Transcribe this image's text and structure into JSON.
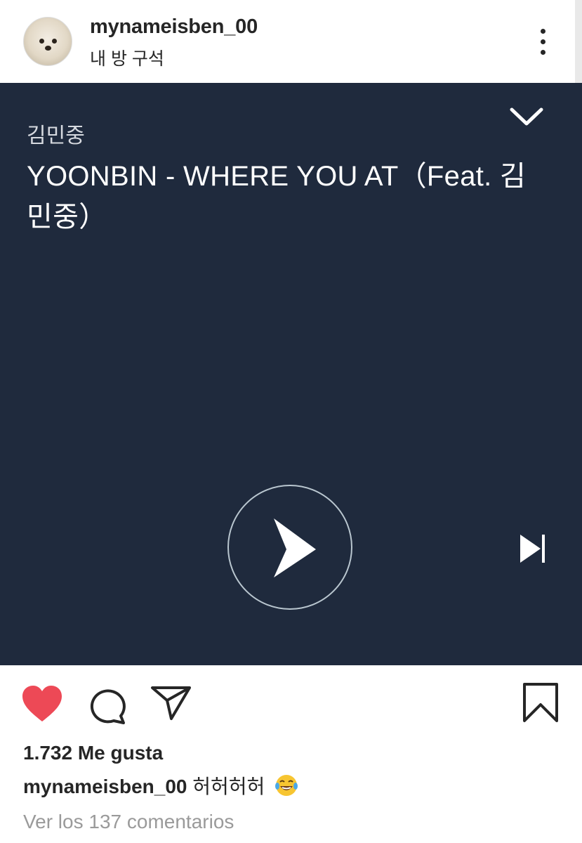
{
  "header": {
    "username": "mynameisben_00",
    "location": "내 방 구석"
  },
  "player": {
    "artist": "김민중",
    "track_title": "YOONBIN - WHERE YOU AT（Feat. 김민중）",
    "background_color": "#1f2a3d"
  },
  "actions": {
    "liked": true,
    "like_color": "#ed4956",
    "icons": [
      "heart-icon",
      "comment-icon",
      "share-icon",
      "bookmark-icon"
    ]
  },
  "post": {
    "likes_text": "1.732 Me gusta",
    "caption_user": "mynameisben_00",
    "caption_text": "허허허허",
    "caption_emoji": "face-with-tears-of-joy",
    "comments_link": "Ver los 137 comentarios"
  }
}
